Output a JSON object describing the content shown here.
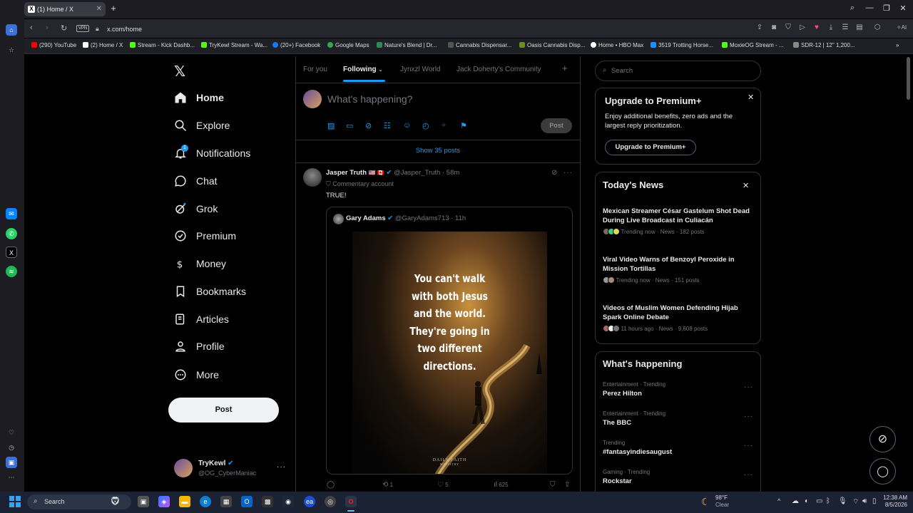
{
  "browser": {
    "tab_title": "(1) Home / X",
    "url": "x.com/home",
    "vpn_label": "VPN",
    "bookmarks": [
      {
        "label": "(290) YouTube",
        "color": "#ff0000"
      },
      {
        "label": "(2) Home / X",
        "color": "#ffffff"
      },
      {
        "label": "Stream - Kick Dashb...",
        "color": "#53fc18"
      },
      {
        "label": "TryKewl Stream - Wa...",
        "color": "#53fc18"
      },
      {
        "label": "(20+) Facebook",
        "color": "#1877f2"
      },
      {
        "label": "Google Maps",
        "color": "#34a853"
      },
      {
        "label": "Nature's Blend | Dr...",
        "color": "#2e8b57"
      },
      {
        "label": "Cannabis Dispensar...",
        "color": "#555555"
      },
      {
        "label": "Oasis Cannabis Disp...",
        "color": "#6b8e23"
      },
      {
        "label": "Home • HBO Max",
        "color": "#ffffff"
      },
      {
        "label": "3519 Trotting Horse...",
        "color": "#1e90ff"
      },
      {
        "label": "MoxieOG Stream - ...",
        "color": "#53fc18"
      },
      {
        "label": "SDR-12 | 12\" 1,200...",
        "color": "#888888"
      }
    ]
  },
  "nav": {
    "items": [
      {
        "label": "Home",
        "icon": "home-icon",
        "bold": true
      },
      {
        "label": "Explore",
        "icon": "search-icon"
      },
      {
        "label": "Notifications",
        "icon": "bell-icon",
        "badge": "1"
      },
      {
        "label": "Chat",
        "icon": "chat-icon"
      },
      {
        "label": "Grok",
        "icon": "grok-icon"
      },
      {
        "label": "Premium",
        "icon": "premium-icon"
      },
      {
        "label": "Money",
        "icon": "money-icon"
      },
      {
        "label": "Bookmarks",
        "icon": "bookmark-icon"
      },
      {
        "label": "Articles",
        "icon": "articles-icon"
      },
      {
        "label": "Profile",
        "icon": "profile-icon"
      },
      {
        "label": "More",
        "icon": "more-icon"
      }
    ],
    "post_label": "Post",
    "account_name": "TryKewl",
    "account_handle": "@OG_CyberManiac"
  },
  "feed": {
    "tabs": [
      "For you",
      "Following",
      "Jynxzl World",
      "Jack Doherty's Community"
    ],
    "active_tab": "Following",
    "compose_placeholder": "What's happening?",
    "compose_post_label": "Post",
    "show_posts": "Show 35 posts",
    "post": {
      "author": "Jasper Truth",
      "flags": "🇺🇸 🇨🇦",
      "handle": "@Jasper_Truth",
      "time": "58m",
      "subline": "Commentary account",
      "text": "TRUE!",
      "quote": {
        "author": "Gary Adams",
        "handle": "@GaryAdams713",
        "time": "11h",
        "image_text": [
          "You can't walk",
          "with both Jesus",
          "and the world.",
          "They're going in",
          "two different",
          "directions."
        ],
        "watermark": [
          "DAILY FAITH",
          "MINISTRY"
        ]
      },
      "actions": {
        "replies": "",
        "reposts": "1",
        "likes": "5",
        "views": "625"
      }
    }
  },
  "sidebar": {
    "search_placeholder": "Search",
    "premium": {
      "title": "Upgrade to Premium+",
      "body": "Enjoy additional benefits, zero ads and the largest reply prioritization.",
      "button": "Upgrade to Premium+"
    },
    "news": {
      "title": "Today's News",
      "items": [
        {
          "title": "Mexican Streamer César Gastelum Shot Dead During Live Broadcast in Culiacán",
          "meta": "Trending now · News · 182 posts"
        },
        {
          "title": "Viral Video Warns of Benzoyl Peroxide in Mission Tortillas",
          "meta": "Trending now · News · 151 posts"
        },
        {
          "title": "Videos of Muslim Women Defending Hijab Spark Online Debate",
          "meta": "11 hours ago · News · 9,608 posts"
        }
      ]
    },
    "happening": {
      "title": "What's happening",
      "items": [
        {
          "category": "Entertainment · Trending",
          "name": "Perez Hilton"
        },
        {
          "category": "Entertainment · Trending",
          "name": "The BBC"
        },
        {
          "category": "Trending",
          "name": "#fantasyindiesaugust"
        },
        {
          "category": "Gaming · Trending",
          "name": "Rockstar"
        }
      ]
    }
  },
  "taskbar": {
    "search_label": "Search",
    "weather_temp": "98°F",
    "weather_desc": "Clear",
    "time": "12:38 AM",
    "date": "8/5/2026"
  },
  "colors": {
    "accent": "#1d9bf0",
    "bg": "#000000",
    "border": "#2f3336"
  }
}
